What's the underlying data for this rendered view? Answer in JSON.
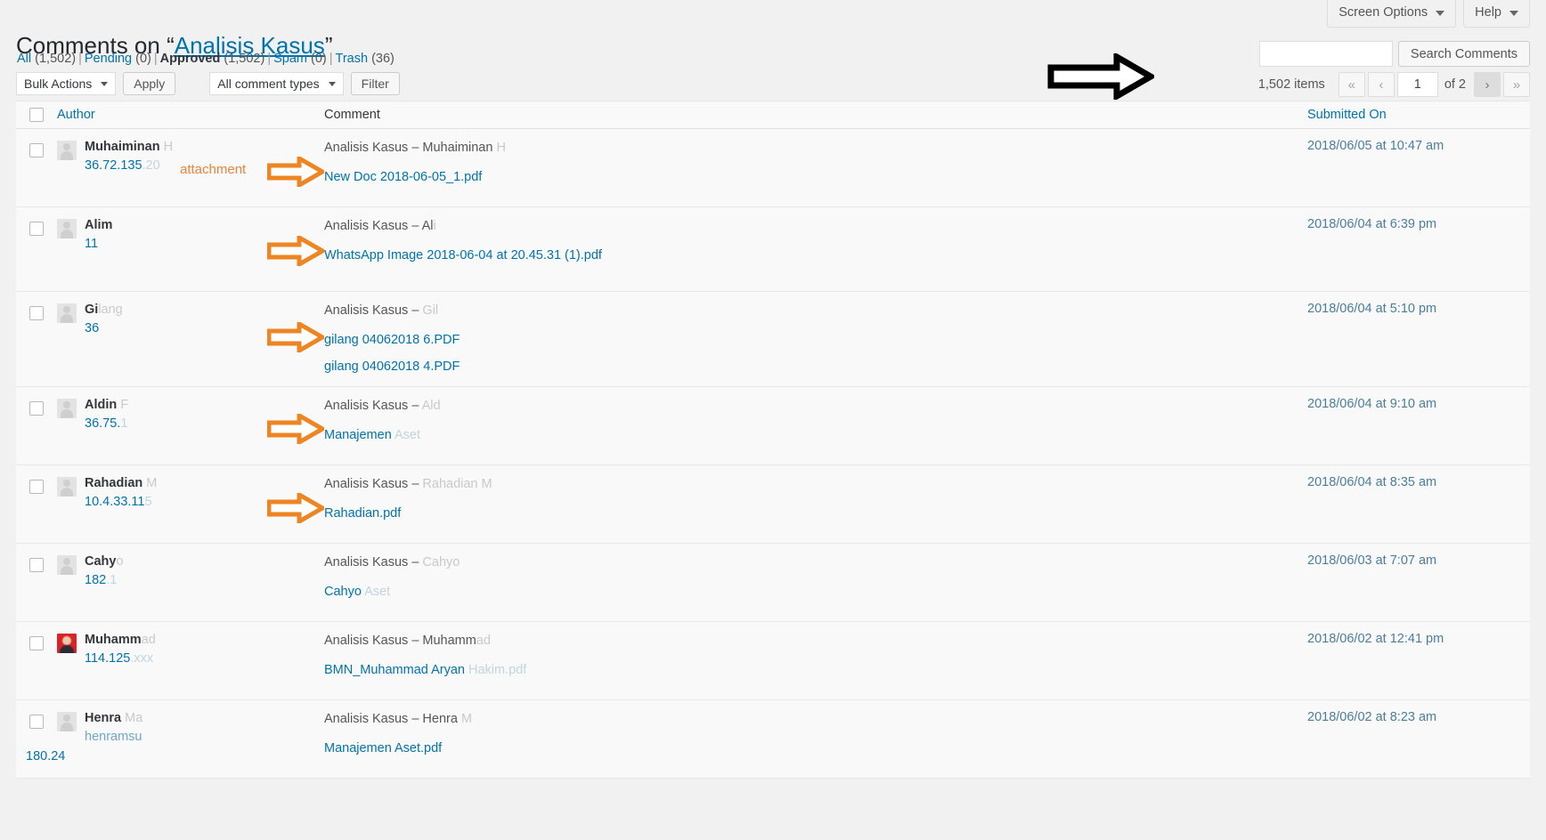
{
  "screen_meta": {
    "screen_options": "Screen Options",
    "help": "Help"
  },
  "header": {
    "title_prefix": "Comments on “",
    "title_link": "Analisis Kasus",
    "title_suffix": "”"
  },
  "filters": {
    "all_label": "All",
    "all_count": "(1,502)",
    "pending_label": "Pending",
    "pending_count": "(0)",
    "approved_label": "Approved",
    "approved_count": "(1,502)",
    "spam_label": "Spam",
    "spam_count": "(0)",
    "trash_label": "Trash",
    "trash_count": "(36)"
  },
  "search": {
    "value": "",
    "placeholder": "",
    "submit_label": "Search Comments"
  },
  "toolbar": {
    "bulk_actions_label": "Bulk Actions",
    "apply_label": "Apply",
    "comment_types_label": "All comment types",
    "filter_label": "Filter"
  },
  "pagination": {
    "items_count": "1,502 items",
    "first_label": "«",
    "prev_label": "‹",
    "current_page": "1",
    "of_total": "of 2",
    "next_label": "›",
    "last_label": "»"
  },
  "table": {
    "columns": {
      "author": "Author",
      "comment": "Comment",
      "date": "Submitted On"
    },
    "rows": [
      {
        "author_name": "Muhaiminan",
        "author_name_faded": " H",
        "author_ip": "36.72.135",
        "author_ip_faded": ".20",
        "author_email": "",
        "author_ip_outdent": "",
        "avatar_type": "placeholder",
        "comment_meta": "Analisis Kasus – Muhaiminan ",
        "comment_meta_faded": "H",
        "attachments": [
          "New Doc 2018-06-05_1.pdf"
        ],
        "attachments_faded": [
          ""
        ],
        "date": "2018/06/05 at 10:47 am"
      },
      {
        "author_name": "Alim",
        "author_name_faded": "",
        "author_ip": "11",
        "author_ip_faded": "",
        "author_email": "",
        "author_ip_outdent": "",
        "avatar_type": "placeholder",
        "comment_meta": "Analisis Kasus – Al",
        "comment_meta_faded": "i",
        "attachments": [
          "WhatsApp Image 2018-06-04 at 20.45.31 (1).pdf"
        ],
        "attachments_faded": [
          ""
        ],
        "date": "2018/06/04 at 6:39 pm"
      },
      {
        "author_name": "Gi",
        "author_name_faded": "lang",
        "author_ip": "36",
        "author_ip_faded": "",
        "author_email": "",
        "author_ip_outdent": "",
        "avatar_type": "placeholder",
        "comment_meta": "Analisis Kasus – ",
        "comment_meta_faded": "Gil",
        "attachments": [
          "gilang 04062018 6.PDF",
          "gilang 04062018 4.PDF"
        ],
        "attachments_faded": [
          "",
          ""
        ],
        "date": "2018/06/04 at 5:10 pm"
      },
      {
        "author_name": "Aldin",
        "author_name_faded": " F",
        "author_ip": "36.75.",
        "author_ip_faded": "1",
        "author_email": "",
        "author_ip_outdent": "",
        "avatar_type": "placeholder",
        "comment_meta": "Analisis Kasus – ",
        "comment_meta_faded": "Ald",
        "attachments": [
          "Manajemen"
        ],
        "attachments_faded": [
          " Aset"
        ],
        "date": "2018/06/04 at 9:10 am"
      },
      {
        "author_name": "Rahadian",
        "author_name_faded": " M",
        "author_ip": "10.4.33.11",
        "author_ip_faded": "5",
        "author_email": "",
        "author_ip_outdent": "",
        "avatar_type": "placeholder",
        "comment_meta": "Analisis Kasus – ",
        "comment_meta_faded": "Rahadian M",
        "attachments": [
          "Rahadian.pdf"
        ],
        "attachments_faded": [
          ""
        ],
        "date": "2018/06/04 at 8:35 am"
      },
      {
        "author_name": "Cahy",
        "author_name_faded": "o",
        "author_ip": "182",
        "author_ip_faded": ".1",
        "author_email": "",
        "author_ip_outdent": "",
        "avatar_type": "placeholder",
        "comment_meta": "Analisis Kasus – ",
        "comment_meta_faded": "Cahyo",
        "attachments": [
          "Cahyo"
        ],
        "attachments_faded": [
          " Aset"
        ],
        "date": "2018/06/03 at 7:07 am"
      },
      {
        "author_name": "Muhamm",
        "author_name_faded": "ad",
        "author_ip": "114.125",
        "author_ip_faded": ".xxx",
        "author_email": "",
        "author_ip_outdent": "",
        "avatar_type": "photo",
        "comment_meta": "Analisis Kasus – Muhamm",
        "comment_meta_faded": "ad",
        "attachments": [
          "BMN_Muhammad Aryan"
        ],
        "attachments_faded": [
          " Hakim.pdf"
        ],
        "date": "2018/06/02 at 12:41 pm"
      },
      {
        "author_name": "Henra",
        "author_name_faded": " Ma",
        "author_ip": "",
        "author_ip_faded": "",
        "author_email": "henramsu",
        "author_ip_outdent": "180",
        "author_ip_outdent_faded": ".24",
        "avatar_type": "placeholder",
        "comment_meta": "Analisis Kasus – Henra",
        "comment_meta_faded": " M",
        "attachments": [
          "Manajemen Aset.pdf"
        ],
        "attachments_faded": [
          ""
        ],
        "date": "2018/06/02 at 8:23 am"
      }
    ]
  },
  "annotations": {
    "attachment_label": "attachment",
    "arrow_color": "#ee8523",
    "pointer_color": "#000000"
  }
}
